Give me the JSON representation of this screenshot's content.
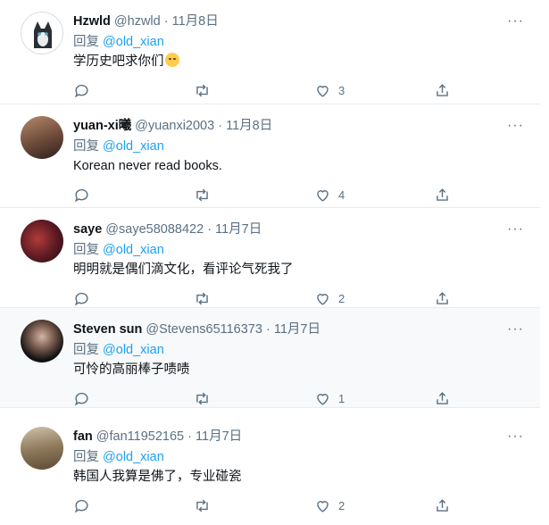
{
  "reply_prefix": "回复",
  "more_glyph": "···",
  "tweets": [
    {
      "name": "Hzwld",
      "handle": "@hzwld",
      "dot": "·",
      "date": "11月8日",
      "reply_to": "@old_xian",
      "text": "学历史吧求你们",
      "emoji": "crying-face",
      "likes": "3",
      "highlighted": false
    },
    {
      "name": "yuan-xi曦",
      "handle": "@yuanxi2003",
      "dot": "·",
      "date": "11月8日",
      "reply_to": "@old_xian",
      "text": "Korean  never read books.",
      "likes": "4",
      "highlighted": false
    },
    {
      "name": "saye",
      "handle": "@saye58088422",
      "dot": "·",
      "date": "11月7日",
      "reply_to": "@old_xian",
      "text": "明明就是偶们滴文化，看评论气死我了",
      "likes": "2",
      "highlighted": false
    },
    {
      "name": "Steven sun",
      "handle": "@Stevens65116373",
      "dot": "·",
      "date": "11月7日",
      "reply_to": "@old_xian",
      "text": "可怜的高丽棒子啧啧",
      "likes": "1",
      "highlighted": true
    },
    {
      "name": "fan",
      "handle": "@fan11952165",
      "dot": "·",
      "date": "11月7日",
      "reply_to": "@old_xian",
      "text": "韩国人我算是佛了，专业碰瓷",
      "likes": "2",
      "highlighted": false
    }
  ],
  "colors": {
    "link": "#1da1f2",
    "muted": "#5b7083",
    "divider": "#e6ecf0",
    "highlight_bg": "#f7f9fa"
  }
}
